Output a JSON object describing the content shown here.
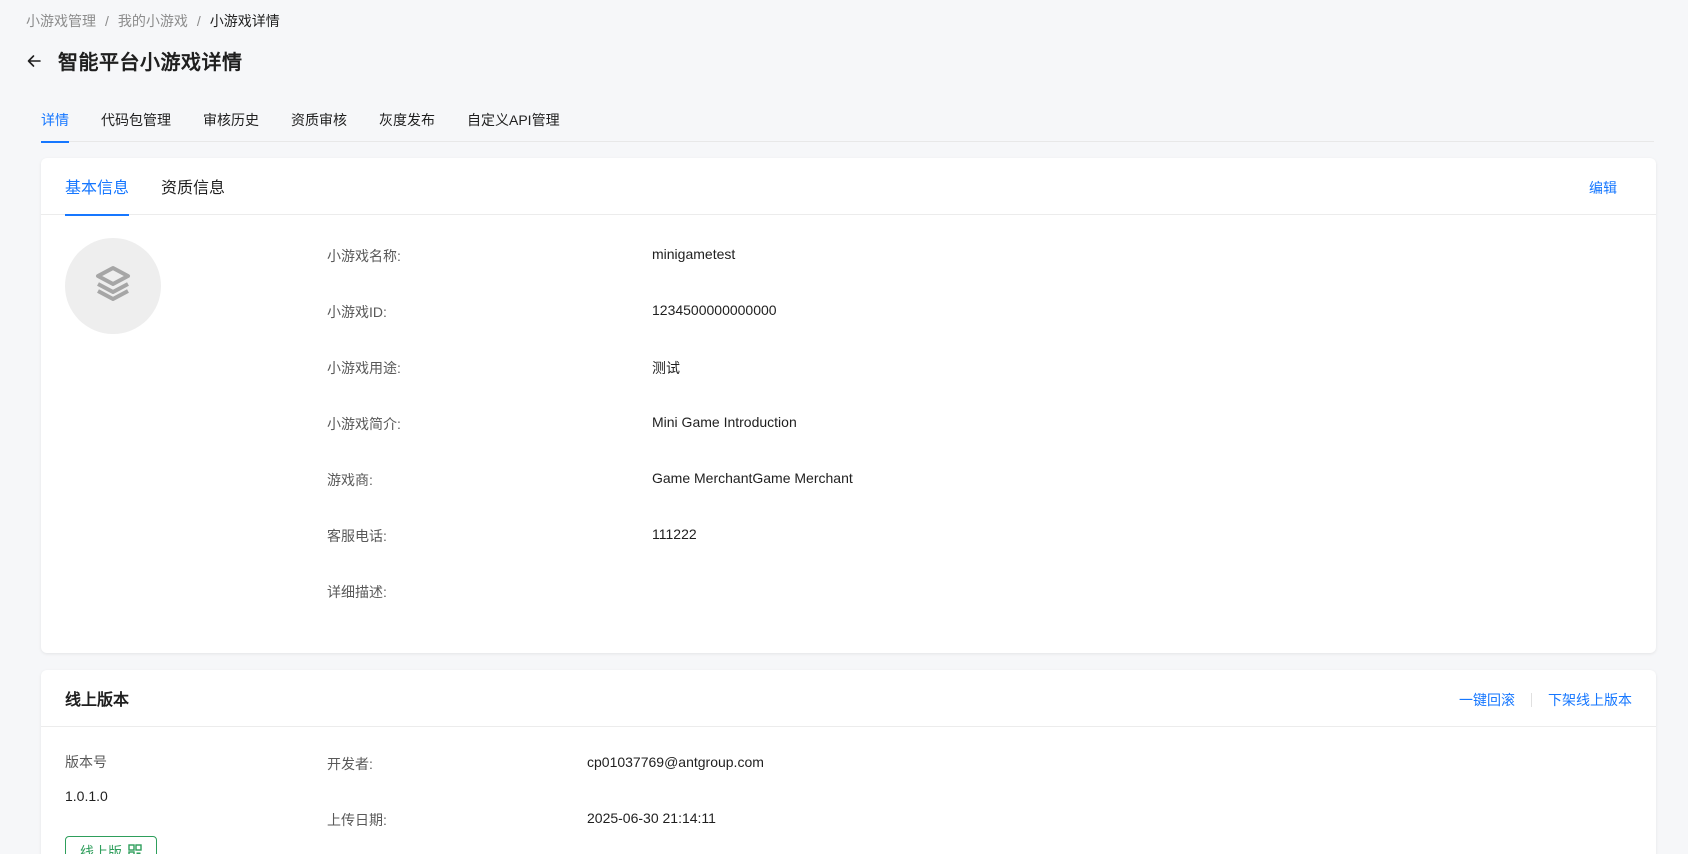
{
  "breadcrumb": {
    "items": [
      "小游戏管理",
      "我的小游戏",
      "小游戏详情"
    ],
    "separator": "/"
  },
  "header": {
    "title": "智能平台小游戏详情",
    "back_icon": "arrow-left-icon"
  },
  "top_tabs": [
    {
      "label": "详情",
      "active": true
    },
    {
      "label": "代码包管理",
      "active": false
    },
    {
      "label": "审核历史",
      "active": false
    },
    {
      "label": "资质审核",
      "active": false
    },
    {
      "label": "灰度发布",
      "active": false
    },
    {
      "label": "自定义API管理",
      "active": false
    }
  ],
  "basic_card": {
    "tabs": [
      {
        "label": "基本信息",
        "active": true
      },
      {
        "label": "资质信息",
        "active": false
      }
    ],
    "edit_label": "编辑",
    "avatar_icon": "layers-icon",
    "fields": [
      {
        "label": "小游戏名称:",
        "value": "minigametest"
      },
      {
        "label": "小游戏ID:",
        "value": "1234500000000000"
      },
      {
        "label": "小游戏用途:",
        "value": "测试"
      },
      {
        "label": "小游戏简介:",
        "value": "Mini Game Introduction"
      },
      {
        "label": "游戏商:",
        "value": "Game MerchantGame Merchant"
      },
      {
        "label": "客服电话:",
        "value": "111222"
      },
      {
        "label": "详细描述:",
        "value": ""
      }
    ]
  },
  "online_card": {
    "title": "线上版本",
    "actions": {
      "rollback": "一键回滚",
      "take_offline": "下架线上版本"
    },
    "version_label": "版本号",
    "version_value": "1.0.1.0",
    "badge_label": "线上版",
    "badge_icon": "qrcode-icon",
    "fields": [
      {
        "label": "开发者:",
        "value": "cp01037769@antgroup.com"
      },
      {
        "label": "上传日期:",
        "value": "2025-06-30 21:14:11"
      }
    ]
  },
  "colors": {
    "accent": "#1677ff",
    "success": "#2e9e5b",
    "background": "#f6f7f9"
  }
}
